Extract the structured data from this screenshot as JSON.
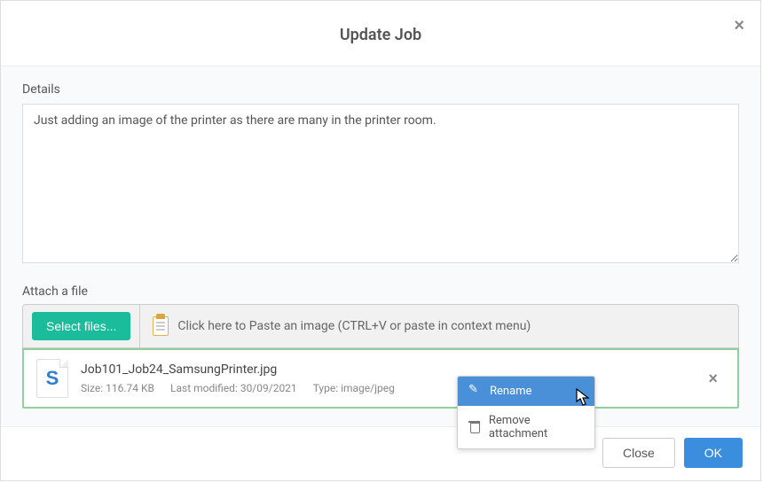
{
  "modal": {
    "title": "Update Job",
    "close_x": "×"
  },
  "details": {
    "label": "Details",
    "value": "Just adding an image of the printer as there are many in the printer room."
  },
  "attach": {
    "label": "Attach a file",
    "select_button": "Select files...",
    "paste_hint": "Click here to Paste an image (CTRL+V or paste in context menu)"
  },
  "file": {
    "thumb_letter": "S",
    "name": "Job101_Job24_SamsungPrinter.jpg",
    "size_label": "Size: 116.74 KB",
    "modified_label": "Last modified: 30/09/2021",
    "type_label": "Type: image/jpeg",
    "remove_x": "×"
  },
  "context_menu": {
    "rename": "Rename",
    "remove": "Remove attachment"
  },
  "footer": {
    "close": "Close",
    "ok": "OK"
  }
}
